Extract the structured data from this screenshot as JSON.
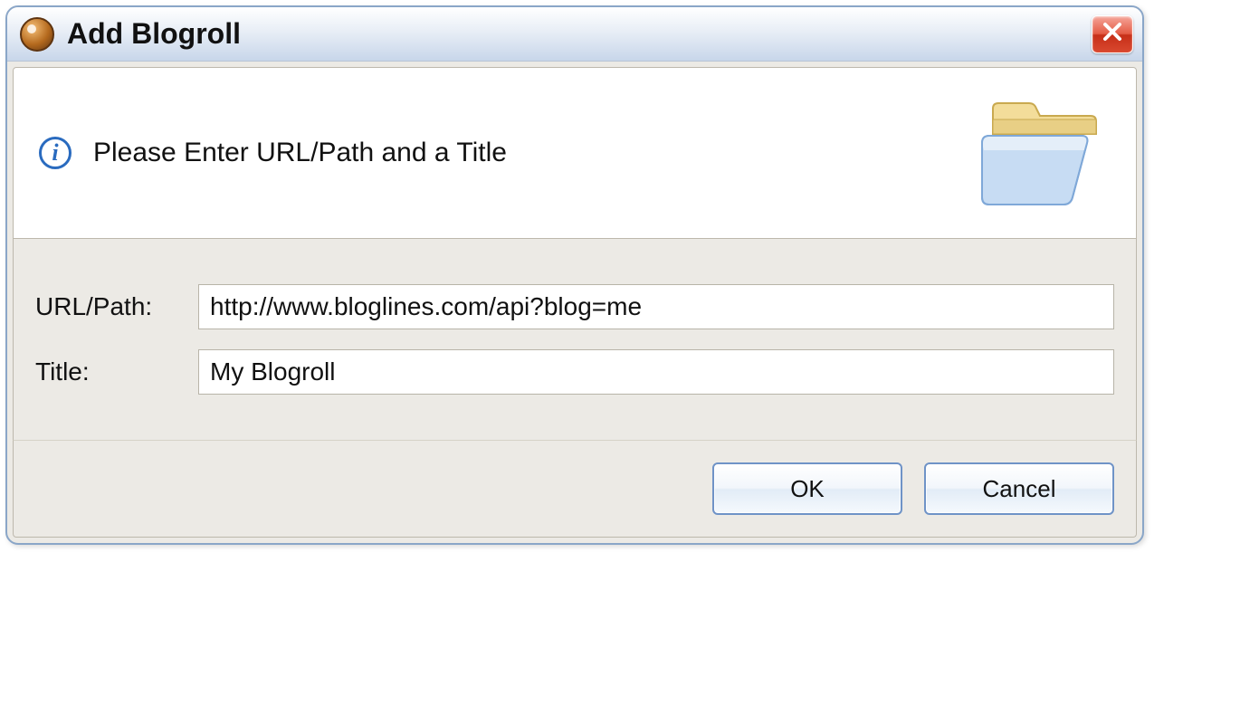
{
  "titlebar": {
    "title": "Add Blogroll"
  },
  "header": {
    "instruction": "Please Enter URL/Path and a Title"
  },
  "form": {
    "url": {
      "label": "URL/Path:",
      "value": "http://www.bloglines.com/api?blog=me"
    },
    "title": {
      "label": "Title:",
      "value": "My Blogroll"
    }
  },
  "buttons": {
    "ok": "OK",
    "cancel": "Cancel"
  }
}
